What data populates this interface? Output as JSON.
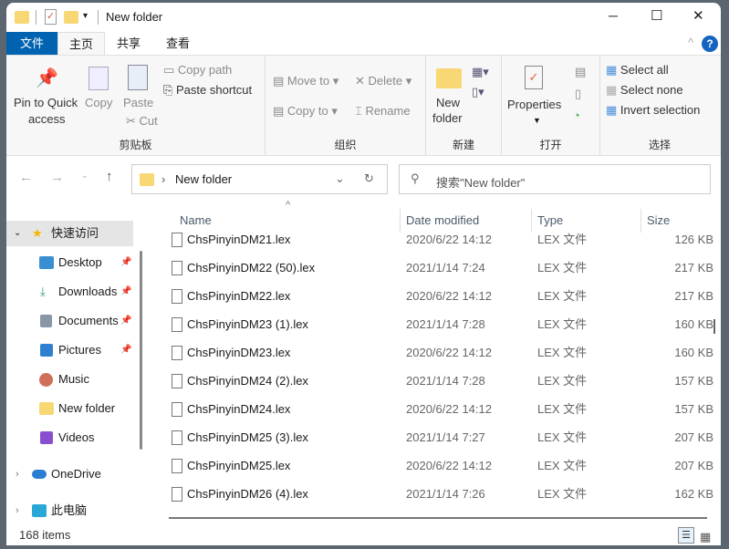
{
  "title": "New folder",
  "window_controls": {
    "minimize": "─",
    "maximize": "☐",
    "close": "✕"
  },
  "tabs": [
    "文件",
    "主页",
    "共享",
    "查看"
  ],
  "ribbon": {
    "clipboard": {
      "pin": "Pin to Quick",
      "pin2": "access",
      "copy": "Copy",
      "paste": "Paste",
      "copy_path": "Copy path",
      "paste_shortcut": "Paste shortcut",
      "cut": "Cut",
      "label": "剪贴板"
    },
    "organize": {
      "move_to": "Move to",
      "copy_to": "Copy to",
      "delete": "Delete",
      "rename": "Rename",
      "label": "组织"
    },
    "new": {
      "new_folder": "New",
      "new_folder2": "folder",
      "label": "新建"
    },
    "open": {
      "properties": "Properties",
      "label": "打开"
    },
    "select": {
      "select_all": "Select all",
      "select_none": "Select none",
      "invert": "Invert selection",
      "label": "选择"
    }
  },
  "address": {
    "crumb": "New folder",
    "search_placeholder": "搜索\"New folder\""
  },
  "sidebar": {
    "quick_access": "快速访问",
    "items": [
      "Desktop",
      "Downloads",
      "Documents",
      "Pictures",
      "Music",
      "New folder",
      "Videos"
    ],
    "onedrive": "OneDrive",
    "this_pc": "此电脑"
  },
  "columns": [
    "Name",
    "Date modified",
    "Type",
    "Size"
  ],
  "files": [
    [
      "ChsPinyinDM21.lex",
      "2020/6/22 14:12",
      "LEX 文件",
      "126 KB"
    ],
    [
      "ChsPinyinDM22 (50).lex",
      "2021/1/14 7:24",
      "LEX 文件",
      "217 KB"
    ],
    [
      "ChsPinyinDM22.lex",
      "2020/6/22 14:12",
      "LEX 文件",
      "217 KB"
    ],
    [
      "ChsPinyinDM23 (1).lex",
      "2021/1/14 7:28",
      "LEX 文件",
      "160 KB"
    ],
    [
      "ChsPinyinDM23.lex",
      "2020/6/22 14:12",
      "LEX 文件",
      "160 KB"
    ],
    [
      "ChsPinyinDM24 (2).lex",
      "2021/1/14 7:28",
      "LEX 文件",
      "157 KB"
    ],
    [
      "ChsPinyinDM24.lex",
      "2020/6/22 14:12",
      "LEX 文件",
      "157 KB"
    ],
    [
      "ChsPinyinDM25 (3).lex",
      "2021/1/14 7:27",
      "LEX 文件",
      "207 KB"
    ],
    [
      "ChsPinyinDM25.lex",
      "2020/6/22 14:12",
      "LEX 文件",
      "207 KB"
    ],
    [
      "ChsPinyinDM26 (4).lex",
      "2021/1/14 7:26",
      "LEX 文件",
      "162 KB"
    ]
  ],
  "status": {
    "count": "168 items"
  },
  "colors": {
    "accent": "#0063b1",
    "folder": "#f8d775"
  }
}
